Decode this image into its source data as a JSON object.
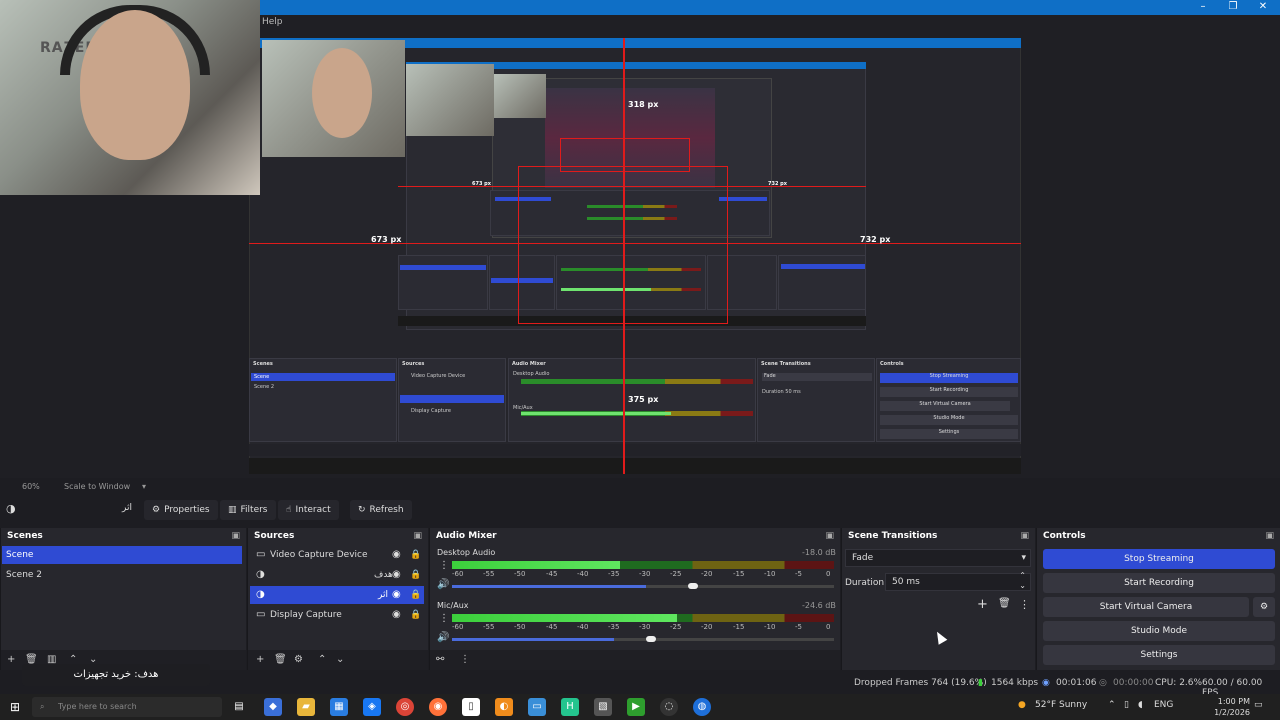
{
  "window": {
    "menu_help": "Help",
    "controls": [
      "–",
      "❐",
      "✕"
    ]
  },
  "preview": {
    "measures": {
      "top": "318 px",
      "left_inner": "673 px",
      "right_inner": "732 px",
      "left": "673 px",
      "right": "732 px",
      "bottom": "375 px"
    },
    "webcam_brand": "RAZER",
    "nested_taskbar_text": "هدف: خرید تجهیزات"
  },
  "zoom": {
    "level": "60%",
    "scale_mode": "Scale to Window"
  },
  "toolbar": {
    "source_name": "اثر",
    "properties": "Properties",
    "filters": "Filters",
    "interact": "Interact",
    "refresh": "Refresh"
  },
  "scenes": {
    "title": "Scenes",
    "items": [
      {
        "label": "Scene",
        "selected": true
      },
      {
        "label": "Scene 2",
        "selected": false
      }
    ]
  },
  "sources": {
    "title": "Sources",
    "items": [
      {
        "label": "Video Capture Device",
        "icon": "camera-icon",
        "selected": false
      },
      {
        "label": "هدف",
        "icon": "browser-icon",
        "selected": false
      },
      {
        "label": "اثر",
        "icon": "browser-icon",
        "selected": true
      },
      {
        "label": "Display Capture",
        "icon": "monitor-icon",
        "selected": false
      }
    ]
  },
  "mixer": {
    "title": "Audio Mixer",
    "channels": [
      {
        "name": "Desktop Audio",
        "db": "-18.0 dB",
        "level": 0.44,
        "volume": 0.63
      },
      {
        "name": "Mic/Aux",
        "db": "-24.6 dB",
        "level": 0.59,
        "volume": 0.52
      }
    ],
    "ticks": [
      "-60",
      "-55",
      "-50",
      "-45",
      "-40",
      "-35",
      "-30",
      "-25",
      "-20",
      "-15",
      "-10",
      "-5",
      "0"
    ]
  },
  "transitions": {
    "title": "Scene Transitions",
    "type": "Fade",
    "duration_label": "Duration",
    "duration_value": "50 ms"
  },
  "controls": {
    "title": "Controls",
    "stop_streaming": "Stop Streaming",
    "start_recording": "Start Recording",
    "start_virtual_camera": "Start Virtual Camera",
    "studio_mode": "Studio Mode",
    "settings": "Settings"
  },
  "status": {
    "dropped_frames": "Dropped Frames 764 (19.6%)",
    "bitrate": "1564 kbps",
    "stream_time": "00:01:06",
    "record_time": "00:00:00",
    "cpu": "CPU: 2.6%",
    "fps": "60.00 / 60.00 FPS"
  },
  "overlay": {
    "goal_text": "هدف: خرید تجهیزات"
  },
  "taskbar": {
    "search_placeholder": "Type here to search",
    "weather": "52°F  Sunny",
    "language": "ENG",
    "time": "1:00 PM",
    "date": "1/2/2026"
  },
  "colors": {
    "accent": "#2f4bd3",
    "titlebar": "#0f6fc6",
    "measure_line": "#e01b1b"
  }
}
